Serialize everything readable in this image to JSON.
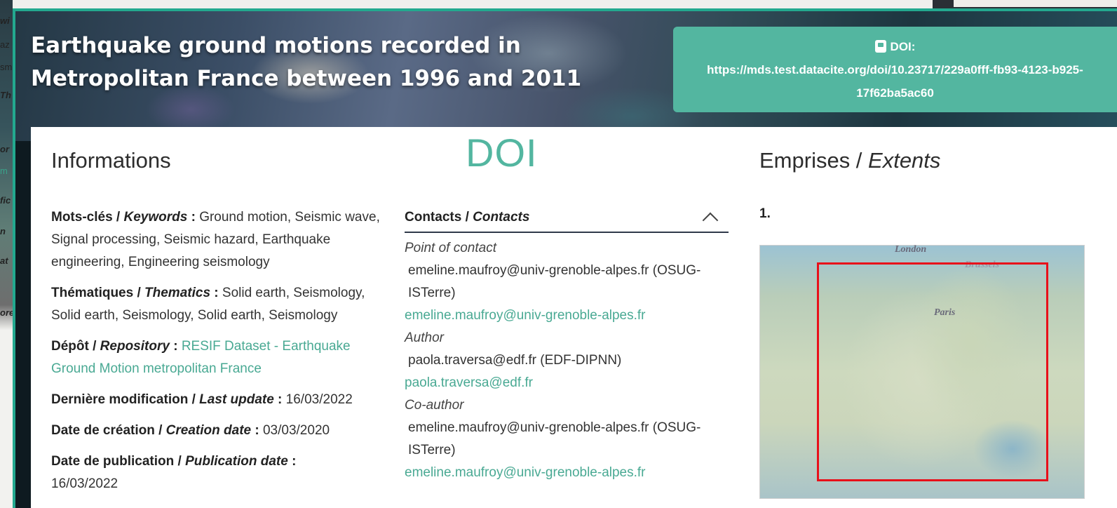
{
  "side_fragments": [
    "wi",
    "az",
    "sm",
    "Th",
    "or",
    "m",
    "fic",
    "n",
    "at",
    "ore"
  ],
  "banner": {
    "title": "Earthquake ground motions recorded in Metropolitan France between 1996 and 2011",
    "doi_label": "DOI:",
    "doi_url": "https://mds.test.datacite.org/doi/10.23717/229a0fff-fb93-4123-b925-17f62ba5ac60"
  },
  "overlay": {
    "doi_big": "DOI"
  },
  "informations": {
    "heading": "Informations",
    "keywords_label_fr": "Mots-clés / ",
    "keywords_label_en": "Keywords",
    "keywords_sep": " : ",
    "keywords_value": "Ground motion, Seismic wave, Signal processing, Seismic hazard, Earthquake engineering, Engineering seismology",
    "thematics_label_fr": "Thématiques / ",
    "thematics_label_en": "Thematics",
    "thematics_sep": " : ",
    "thematics_value": "Solid earth, Seismology, Solid earth, Seismology, Solid earth, Seismology",
    "repository_label_fr": "Dépôt / ",
    "repository_label_en": "Repository",
    "repository_sep": " : ",
    "repository_value": "RESIF Dataset - Earthquake Ground Motion metropolitan France",
    "last_update_label_fr": "Dernière modification / ",
    "last_update_label_en": "Last update",
    "last_update_sep": " : ",
    "last_update_value": "16/03/2022",
    "creation_label_fr": "Date de création / ",
    "creation_label_en": "Creation date",
    "creation_sep": " : ",
    "creation_value": "03/03/2020",
    "publication_label_fr": "Date de publication / ",
    "publication_label_en": "Publication date",
    "publication_sep": " :",
    "publication_value": "16/03/2022"
  },
  "contacts": {
    "header_fr": "Contacts / ",
    "header_en": "Contacts",
    "entries": [
      {
        "role": "Point of contact",
        "name": "emeline.maufroy@univ-grenoble-alpes.fr (OSUG-ISTerre)",
        "email": "emeline.maufroy@univ-grenoble-alpes.fr"
      },
      {
        "role": "Author",
        "name": "paola.traversa@edf.fr (EDF-DIPNN)",
        "email": "paola.traversa@edf.fr"
      },
      {
        "role": "Co-author",
        "name": "emeline.maufroy@univ-grenoble-alpes.fr (OSUG-ISTerre)",
        "email": "emeline.maufroy@univ-grenoble-alpes.fr"
      }
    ]
  },
  "extents": {
    "heading_fr": "Emprises / ",
    "heading_en": "Extents",
    "item_number": "1.",
    "map_labels": {
      "london": "London",
      "brussels": "Brussels",
      "paris": "Paris"
    },
    "bbox_color": "#e8101a"
  },
  "colors": {
    "accent": "#53b6a0",
    "link": "#49a993",
    "frame_border": "#23a98f"
  }
}
